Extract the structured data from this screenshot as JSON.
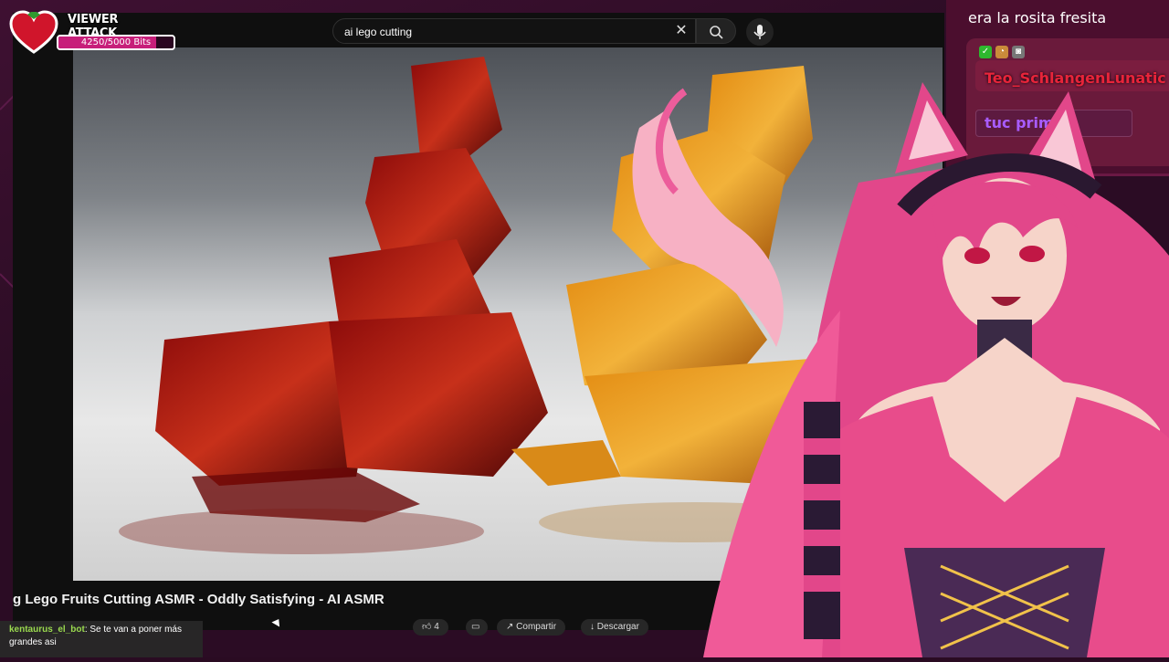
{
  "viewer_attack": {
    "title": "VIEWER ATTACK",
    "progress_text": "4250/5000 Bits",
    "progress_fraction": 0.85
  },
  "search": {
    "value": "ai lego cutting"
  },
  "video": {
    "title": "g Lego Fruits Cutting ASMR - Oddly Satisfying - AI ASMR",
    "like_count": "4",
    "share_label": "Compartir",
    "download_label": "Descargar"
  },
  "chat_overlay": {
    "username": "kentaurus_el_bot",
    "message": ": Se te van a poner más grandes asi"
  },
  "chat_panel": {
    "message1": "era la rosita fresita",
    "user1": "Teo_SchlangenLunatic",
    "user2": "tu​c​ primida"
  },
  "colors": {
    "accent": "#c71f7a",
    "chat_bg": "#4b0e2e"
  }
}
